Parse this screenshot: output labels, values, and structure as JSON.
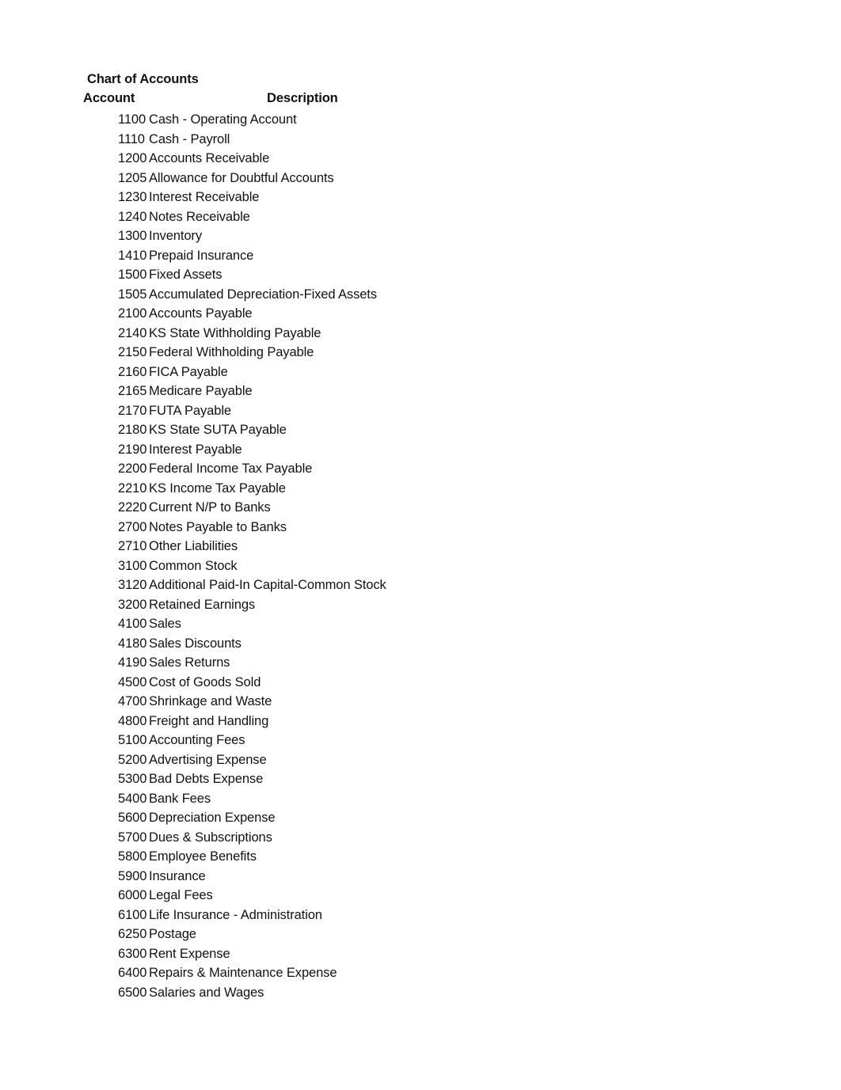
{
  "document": {
    "title": "Chart of Accounts"
  },
  "table": {
    "headers": {
      "account": "Account",
      "description": "Description"
    },
    "rows": [
      {
        "account": "1100",
        "description": "Cash - Operating Account"
      },
      {
        "account": "1110",
        "description": "Cash - Payroll"
      },
      {
        "account": "1200",
        "description": "Accounts Receivable"
      },
      {
        "account": "1205",
        "description": "Allowance for Doubtful Accounts"
      },
      {
        "account": "1230",
        "description": "Interest Receivable"
      },
      {
        "account": "1240",
        "description": "Notes Receivable"
      },
      {
        "account": "1300",
        "description": "Inventory"
      },
      {
        "account": "1410",
        "description": "Prepaid Insurance"
      },
      {
        "account": "1500",
        "description": "Fixed Assets"
      },
      {
        "account": "1505",
        "description": "Accumulated Depreciation-Fixed Assets"
      },
      {
        "account": "2100",
        "description": "Accounts Payable"
      },
      {
        "account": "2140",
        "description": "KS State Withholding Payable"
      },
      {
        "account": "2150",
        "description": "Federal Withholding Payable"
      },
      {
        "account": "2160",
        "description": "FICA Payable"
      },
      {
        "account": "2165",
        "description": "Medicare Payable"
      },
      {
        "account": "2170",
        "description": "FUTA Payable"
      },
      {
        "account": "2180",
        "description": "KS State SUTA Payable"
      },
      {
        "account": "2190",
        "description": "Interest Payable"
      },
      {
        "account": "2200",
        "description": "Federal Income Tax Payable"
      },
      {
        "account": "2210",
        "description": "KS Income Tax Payable"
      },
      {
        "account": "2220",
        "description": "Current N/P to Banks"
      },
      {
        "account": "2700",
        "description": "Notes Payable to Banks"
      },
      {
        "account": "2710",
        "description": "Other Liabilities"
      },
      {
        "account": "3100",
        "description": "Common Stock"
      },
      {
        "account": "3120",
        "description": "Additional Paid-In Capital-Common Stock"
      },
      {
        "account": "3200",
        "description": "Retained Earnings"
      },
      {
        "account": "4100",
        "description": "Sales"
      },
      {
        "account": "4180",
        "description": "Sales Discounts"
      },
      {
        "account": "4190",
        "description": "Sales Returns"
      },
      {
        "account": "4500",
        "description": "Cost of Goods Sold"
      },
      {
        "account": "4700",
        "description": "Shrinkage and Waste"
      },
      {
        "account": "4800",
        "description": "Freight and Handling"
      },
      {
        "account": "5100",
        "description": "Accounting Fees"
      },
      {
        "account": "5200",
        "description": "Advertising Expense"
      },
      {
        "account": "5300",
        "description": "Bad Debts Expense"
      },
      {
        "account": "5400",
        "description": "Bank Fees"
      },
      {
        "account": "5600",
        "description": "Depreciation Expense"
      },
      {
        "account": "5700",
        "description": "Dues & Subscriptions"
      },
      {
        "account": "5800",
        "description": "Employee Benefits"
      },
      {
        "account": "5900",
        "description": "Insurance"
      },
      {
        "account": "6000",
        "description": "Legal Fees"
      },
      {
        "account": "6100",
        "description": "Life Insurance - Administration"
      },
      {
        "account": "6250",
        "description": "Postage"
      },
      {
        "account": "6300",
        "description": "Rent Expense"
      },
      {
        "account": "6400",
        "description": "Repairs & Maintenance Expense"
      },
      {
        "account": "6500",
        "description": "Salaries and Wages"
      }
    ]
  }
}
